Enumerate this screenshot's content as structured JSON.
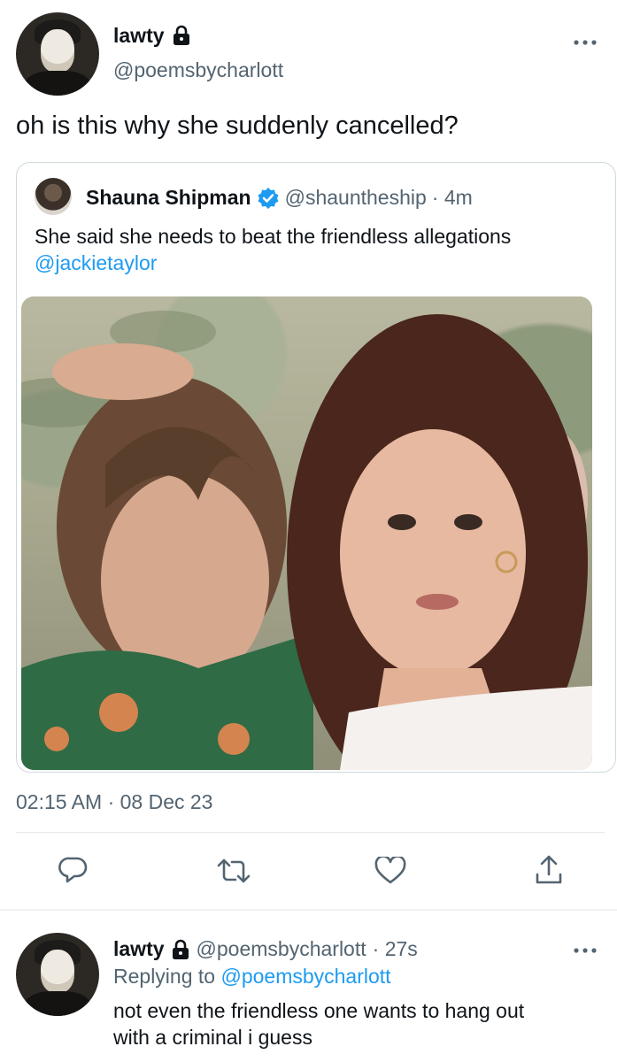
{
  "main_tweet": {
    "name": "lawty",
    "handle": "@poemsbycharlott",
    "text": "oh is this why she suddenly cancelled?",
    "timestamp": "02:15 AM · 08 Dec 23"
  },
  "quoted_tweet": {
    "name": "Shauna Shipman",
    "handle": "@shauntheship",
    "time": "· 4m",
    "text": "She said she needs to beat the friendless allegations",
    "mention": "@jackietaylor"
  },
  "actions": [
    "reply-icon",
    "retweet-icon",
    "like-icon",
    "share-icon"
  ],
  "reply_tweet": {
    "name": "lawty",
    "handle": "@poemsbycharlott",
    "time": "· 27s",
    "replying_label": "Replying to",
    "replying_handle": "@poemsbycharlott",
    "text_line1": "not even the friendless one wants to hang out",
    "text_line2": "with a criminal i guess"
  },
  "colors": {
    "accent": "#1d9bf0",
    "secondary_text": "#536471",
    "primary_text": "#0f1419"
  }
}
